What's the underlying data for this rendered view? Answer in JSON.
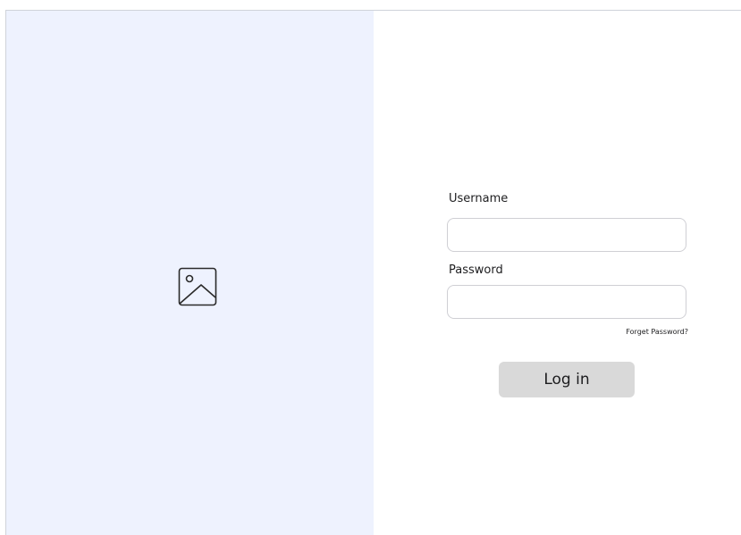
{
  "form": {
    "username_label": "Username",
    "username_value": "",
    "password_label": "Password",
    "password_value": "",
    "forgot_password": "Forget Password?",
    "login_button": "Log in"
  },
  "image_panel": {
    "icon": "image-placeholder-icon",
    "background": "#eef2fe"
  },
  "colors": {
    "button_background": "#d9d9d9",
    "field_border": "#cfcfd4"
  }
}
